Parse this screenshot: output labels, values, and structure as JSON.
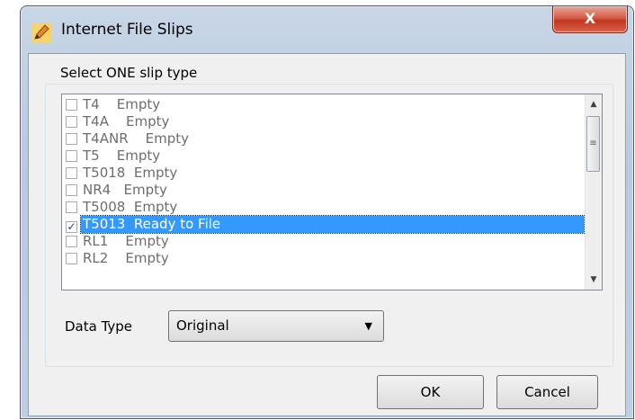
{
  "window": {
    "title": "Internet File Slips",
    "close_label": "X"
  },
  "group": {
    "caption": "Select ONE slip type"
  },
  "slip_list": {
    "items": [
      {
        "code": "T4",
        "status": "Empty",
        "checked": false,
        "selected": false
      },
      {
        "code": "T4A",
        "status": "Empty",
        "checked": false,
        "selected": false
      },
      {
        "code": "T4ANR",
        "status": "Empty",
        "checked": false,
        "selected": false
      },
      {
        "code": "T5",
        "status": "Empty",
        "checked": false,
        "selected": false
      },
      {
        "code": "T5018",
        "status": "Empty",
        "checked": false,
        "selected": false
      },
      {
        "code": "NR4",
        "status": "Empty",
        "checked": false,
        "selected": false
      },
      {
        "code": "T5008",
        "status": "Empty",
        "checked": false,
        "selected": false
      },
      {
        "code": "T5013",
        "status": "Ready to File",
        "checked": true,
        "selected": true
      },
      {
        "code": "RL1",
        "status": "Empty",
        "checked": false,
        "selected": false
      },
      {
        "code": "RL2",
        "status": "Empty",
        "checked": false,
        "selected": false
      }
    ],
    "item_text": [
      "T4    Empty",
      "T4A    Empty",
      "T4ANR    Empty",
      "T5    Empty",
      "T5018  Empty",
      "NR4   Empty",
      "T5008  Empty",
      "T5013  Ready to File",
      "RL1    Empty",
      "RL2    Empty"
    ]
  },
  "data_type": {
    "label": "Data Type",
    "selected": "Original"
  },
  "buttons": {
    "ok": "OK",
    "cancel": "Cancel"
  },
  "colors": {
    "selection": "#3399ff",
    "close_button": "#c2361f",
    "dialog_face": "#f0f0f0"
  },
  "icons": {
    "app": "pencil-app-icon",
    "scroll_up": "triangle-up",
    "scroll_down": "triangle-down",
    "dropdown": "triangle-down"
  }
}
